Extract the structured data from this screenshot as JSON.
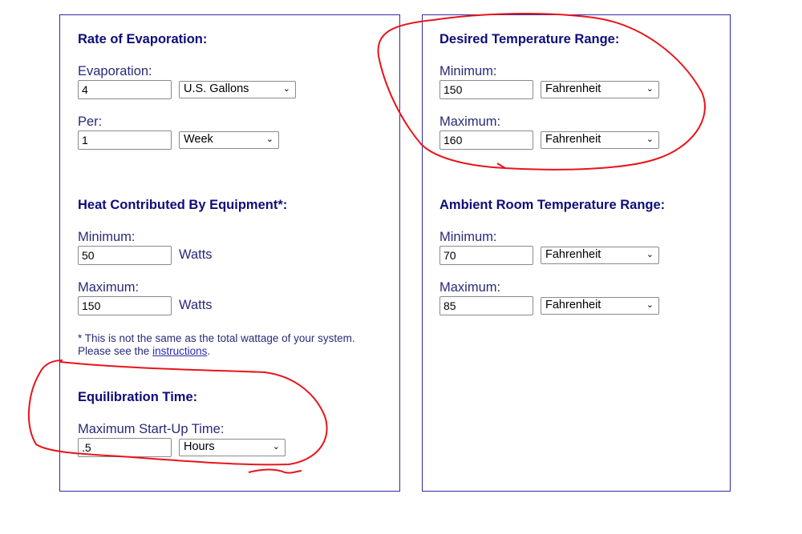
{
  "evaporation": {
    "heading": "Rate of Evaporation:",
    "evap_label": "Evaporation:",
    "evap_value": "4",
    "evap_unit": "U.S. Gallons",
    "per_label": "Per:",
    "per_value": "1",
    "per_unit": "Week"
  },
  "heat": {
    "heading": "Heat Contributed By Equipment*:",
    "min_label": "Minimum:",
    "min_value": "50",
    "max_label": "Maximum:",
    "max_value": "150",
    "unit": "Watts",
    "note_line1": "* This is not the same as the total wattage of your system.",
    "note_prefix": "Please see the ",
    "note_link": "instructions",
    "note_suffix": "."
  },
  "equilibration": {
    "heading": "Equilibration Time:",
    "label": "Maximum Start-Up Time:",
    "value": ".5",
    "unit": "Hours"
  },
  "desired": {
    "heading": "Desired Temperature Range:",
    "min_label": "Minimum:",
    "min_value": "150",
    "min_unit": "Fahrenheit",
    "max_label": "Maximum:",
    "max_value": "160",
    "max_unit": "Fahrenheit"
  },
  "ambient": {
    "heading": "Ambient Room Temperature Range:",
    "min_label": "Minimum:",
    "min_value": "70",
    "min_unit": "Fahrenheit",
    "max_label": "Maximum:",
    "max_value": "85",
    "max_unit": "Fahrenheit"
  },
  "icons": {
    "select_chevron": "chevron-down-icon"
  },
  "colors": {
    "annotation": "#e8141b",
    "border": "#2b2ba6",
    "heading": "#0d0d7a"
  }
}
